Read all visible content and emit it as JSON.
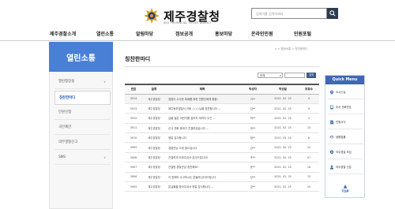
{
  "header": {
    "logo_title": "제주경찰청",
    "logo_subtitle": "JEJU PROVINCIAL POLICE AGENCY",
    "search_placeholder": "검색어를 입력하세요"
  },
  "gnb": [
    {
      "label": "제주경찰소개"
    },
    {
      "label": "열린소통"
    },
    {
      "label": "알림마당"
    },
    {
      "label": "정보공개"
    },
    {
      "label": "홍보마당"
    },
    {
      "label": "온라인민원"
    },
    {
      "label": "민원포털"
    }
  ],
  "sidebar": {
    "title": "열린소통",
    "items": [
      {
        "label": "열린청장실",
        "has_arrow": true,
        "arrow": "∨"
      },
      {
        "label": "칭찬한마디",
        "active": true
      },
      {
        "label": "민원신청"
      },
      {
        "label": "국민제안"
      },
      {
        "label": "의무경찰신고"
      },
      {
        "label": "SNS",
        "has_arrow": true,
        "arrow": "∨"
      }
    ]
  },
  "content": {
    "page_title": "칭찬한마디",
    "breadcrumb": "⌂ > 열린소통 > 칭찬한마디",
    "filter": {
      "select_value": "전체",
      "caret": "∨",
      "search_button": "검색"
    }
  },
  "table": {
    "columns": [
      "번호",
      "분류",
      "제목",
      "작성자",
      "작성일",
      "조회수"
    ],
    "rows": [
      [
        "3914",
        "제주경찰청",
        "경찰이 수사한 특례를 위한 민원인에게 좋음!",
        "이**",
        "2021. 02. 25",
        "9"
      ],
      [
        "3913",
        "제주경찰청",
        "제주동부경찰서 이동 ○○○님을 칭찬합니다 ...",
        "김**",
        "2021. 02. 25",
        "4"
      ],
      [
        "3912",
        "제주경찰청",
        "길을 잃은 어린이를 집까지 데려다 주신 ...",
        "박**",
        "2021. 02. 25",
        "3"
      ],
      [
        "3911",
        "제주경찰청",
        "신고 전화 응대가 친절하셨습니다 ...",
        "최**",
        "2021. 02. 25",
        "15"
      ],
      [
        "3910",
        "제주경찰청",
        "정말 감사합니다",
        "정**",
        "2021. 02. 25",
        "8"
      ],
      [
        "3909",
        "제주경찰청",
        "경찰관님 고생 많으십니다",
        "강**",
        "2021. 02. 25",
        "12"
      ],
      [
        "3908",
        "제주경찰청",
        "친절하게 도와주셔서 감사드립니다!",
        "조**",
        "2021. 02. 25",
        "47"
      ],
      [
        "3907",
        "제주경찰청",
        "친절한 경찰관님 칭찬해요?",
        "윤**",
        "2021. 02. 25",
        "16"
      ],
      [
        "3906",
        "제주경찰청",
        "이 밤에도 수고하시는 분들께 감사드립니다",
        "장**",
        "2021. 02. 25",
        "13"
      ],
      [
        "3905",
        "제주경찰청",
        "분실물을 찾아주셔서 정말 감사합니다 ...",
        "임**",
        "2021. 02. 25",
        "15"
      ]
    ]
  },
  "quick_menu": {
    "title": "Quick Menu",
    "items": [
      {
        "label": "오시는길",
        "icon": "map-pin-icon"
      },
      {
        "label": "부서 전화번호",
        "icon": "phone-icon"
      },
      {
        "label": "민원서식",
        "icon": "document-icon"
      },
      {
        "label": "생활법률",
        "icon": "scale-icon"
      },
      {
        "label": "의무경찰 모집",
        "icon": "badge-icon"
      },
      {
        "label": "의무경찰 신분",
        "icon": "person-icon"
      }
    ],
    "top_arrow": "▲",
    "top_label": "TOP"
  },
  "colors": {
    "accent": "#4a7fd6",
    "quick_header": "#3f67b5",
    "search_button": "#2f3a4f"
  }
}
